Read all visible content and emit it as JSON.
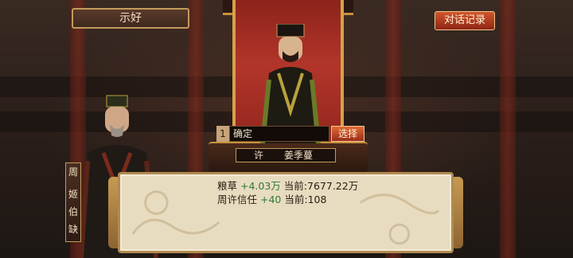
{
  "header": {
    "tab_label": "示好",
    "log_button": "对话记录"
  },
  "choice": {
    "number": "1",
    "option": "确定",
    "select_button": "选择"
  },
  "speaker": {
    "first_char": "许",
    "full_name": "姜季蔓"
  },
  "name_plate": {
    "family": "周",
    "given_1": "姬",
    "given_2": "伯",
    "given_3": "缺"
  },
  "dialog": {
    "lines": [
      {
        "label": "粮草",
        "change": "+4.03万",
        "current_label": "当前:",
        "current_value": "7677.22万"
      },
      {
        "label": "周许信任",
        "change": "+40",
        "current_label": "当前:",
        "current_value": "108"
      }
    ]
  },
  "colors": {
    "positive": "#2f7a34",
    "accent_red": "#8e2415",
    "gold": "#c39a5c"
  }
}
